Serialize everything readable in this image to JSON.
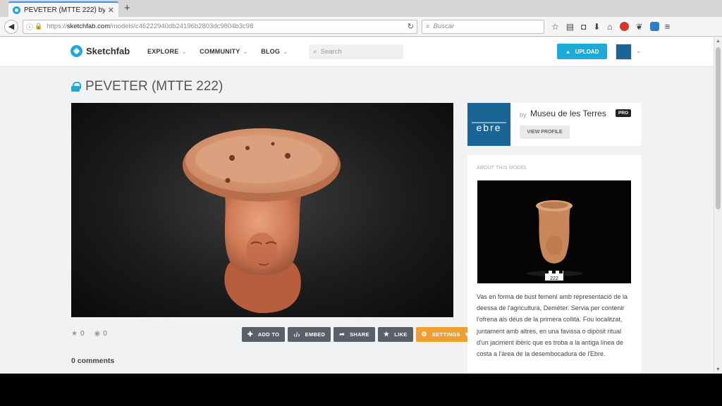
{
  "browser": {
    "tab_title": "PEVETER (MTTE 222) by M...",
    "url_prefix": "https://",
    "url_host": "sketchfab.com",
    "url_path": "/models/c46222940db24196b2803dc9804b3c98",
    "search_placeholder": "Buscar"
  },
  "site": {
    "brand": "Sketchfab",
    "nav": [
      {
        "label": "EXPLORE"
      },
      {
        "label": "COMMUNITY"
      },
      {
        "label": "BLOG"
      }
    ],
    "search_placeholder": "Search",
    "upload_label": "UPLOAD"
  },
  "model": {
    "title": "PEVETER (MTTE 222)",
    "likes": "0",
    "views": "0",
    "comments": "0 comments",
    "actions": {
      "add_to": "ADD TO",
      "embed": "EMBED",
      "share": "SHARE",
      "like": "LIKE",
      "settings": "SETTINGS"
    }
  },
  "author": {
    "by": "by",
    "name": "Museu de les Terres",
    "badge": "PRO",
    "view_profile": "VIEW PROFILE",
    "logo_text": "ebre"
  },
  "about": {
    "heading": "ABOUT THIS MODEL",
    "photo_label": "222",
    "description": "Vas en forma de bust femení amb representació de la deessa de l'agricultura, Demèter. Servia per contenir l'ofrena als déus de la primera collita. Fou localitzat, juntament amb altres, en una favissa o dipòsit ritual d'un jaciment ibèric que es troba a la antiga línea de costa a l'àrea de la desembocadura de l'Ebre."
  },
  "colors": {
    "accent": "#1caad9",
    "settings": "#f0a030",
    "action_button": "#5a6068",
    "author_logo_bg": "#1a6496"
  }
}
